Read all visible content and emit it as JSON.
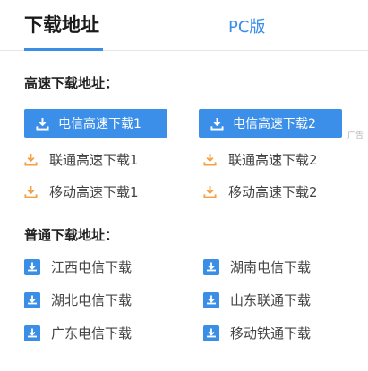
{
  "tabs": {
    "active": "下载地址",
    "pc": "PC版"
  },
  "section_fast": {
    "title": "高速下载地址：",
    "buttons": [
      "电信高速下载1",
      "电信高速下载2"
    ],
    "links_row1": [
      "联通高速下载1",
      "联通高速下载2"
    ],
    "links_row2": [
      "移动高速下载1",
      "移动高速下载2"
    ],
    "ad_label": "广告"
  },
  "section_normal": {
    "title": "普通下载地址：",
    "mirrors": [
      "江西电信下载",
      "湖南电信下载",
      "湖北电信下载",
      "山东联通下载",
      "广东电信下载",
      "移动铁通下载"
    ]
  },
  "colors": {
    "accent": "#3b8fe8",
    "orange": "#f5a043",
    "mirror_icon": "#3a8ee6"
  }
}
